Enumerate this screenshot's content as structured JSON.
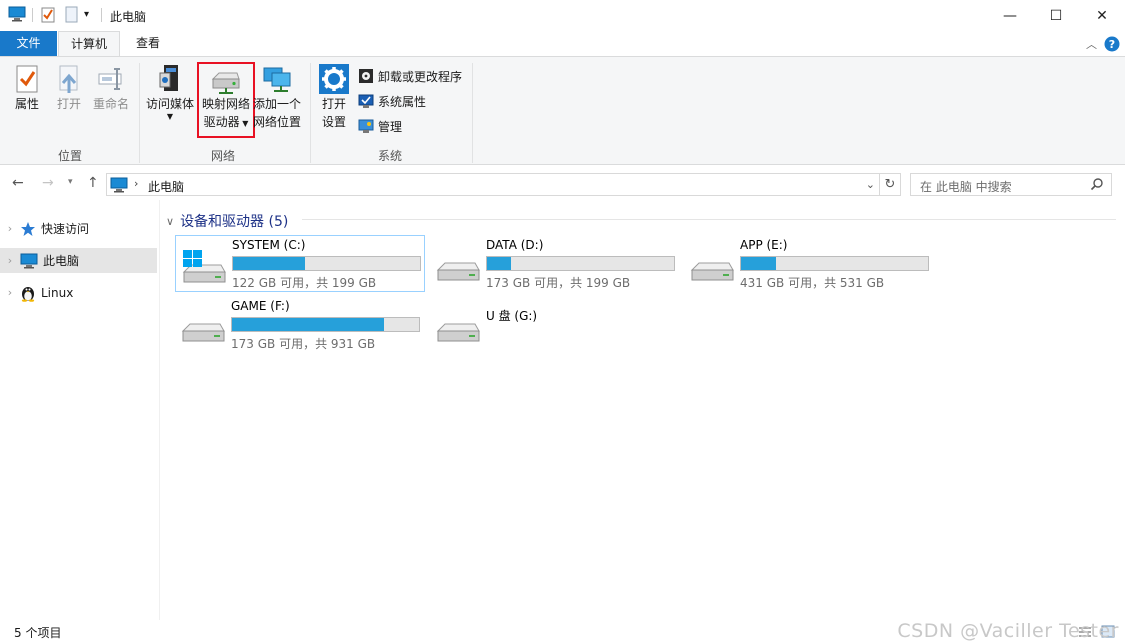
{
  "window": {
    "title": "此电脑",
    "minimize": "—",
    "maximize": "☐",
    "close": "✕"
  },
  "ribbon": {
    "tabs": {
      "file": "文件",
      "computer": "计算机",
      "view": "查看"
    },
    "groups": {
      "location": "位置",
      "network": "网络",
      "system": "系统"
    },
    "buttons": {
      "properties": "属性",
      "open": "打开",
      "rename": "重命名",
      "access_media": "访问媒体",
      "map_drive_line1": "映射网络",
      "map_drive_line2": "驱动器",
      "add_location_line1": "添加一个",
      "add_location_line2": "网络位置",
      "open_settings_line1": "打开",
      "open_settings_line2": "设置",
      "uninstall": "卸载或更改程序",
      "system_properties": "系统属性",
      "manage": "管理"
    }
  },
  "address": {
    "path": "此电脑",
    "search_placeholder": "在 此电脑 中搜索"
  },
  "nav": {
    "items": [
      {
        "label": "快速访问"
      },
      {
        "label": "此电脑"
      },
      {
        "label": "Linux"
      }
    ]
  },
  "content": {
    "group_title": "设备和驱动器 (5)",
    "drives": [
      {
        "name": "SYSTEM (C:)",
        "info": "122 GB 可用，共 199 GB",
        "used_fraction": 0.387
      },
      {
        "name": "DATA (D:)",
        "info": "173 GB 可用，共 199 GB",
        "used_fraction": 0.131
      },
      {
        "name": "APP (E:)",
        "info": "431 GB 可用，共 531 GB",
        "used_fraction": 0.188
      },
      {
        "name": "GAME (F:)",
        "info": "173 GB 可用，共 931 GB",
        "used_fraction": 0.814
      },
      {
        "name": "U 盘 (G:)"
      }
    ]
  },
  "status": {
    "items_count": "5 个项目"
  },
  "watermark": "CSDN @Vaciller Tester",
  "colors": {
    "accent": "#1979ca",
    "drive_fill": "#26a0da",
    "highlight_box": "#e81123"
  }
}
